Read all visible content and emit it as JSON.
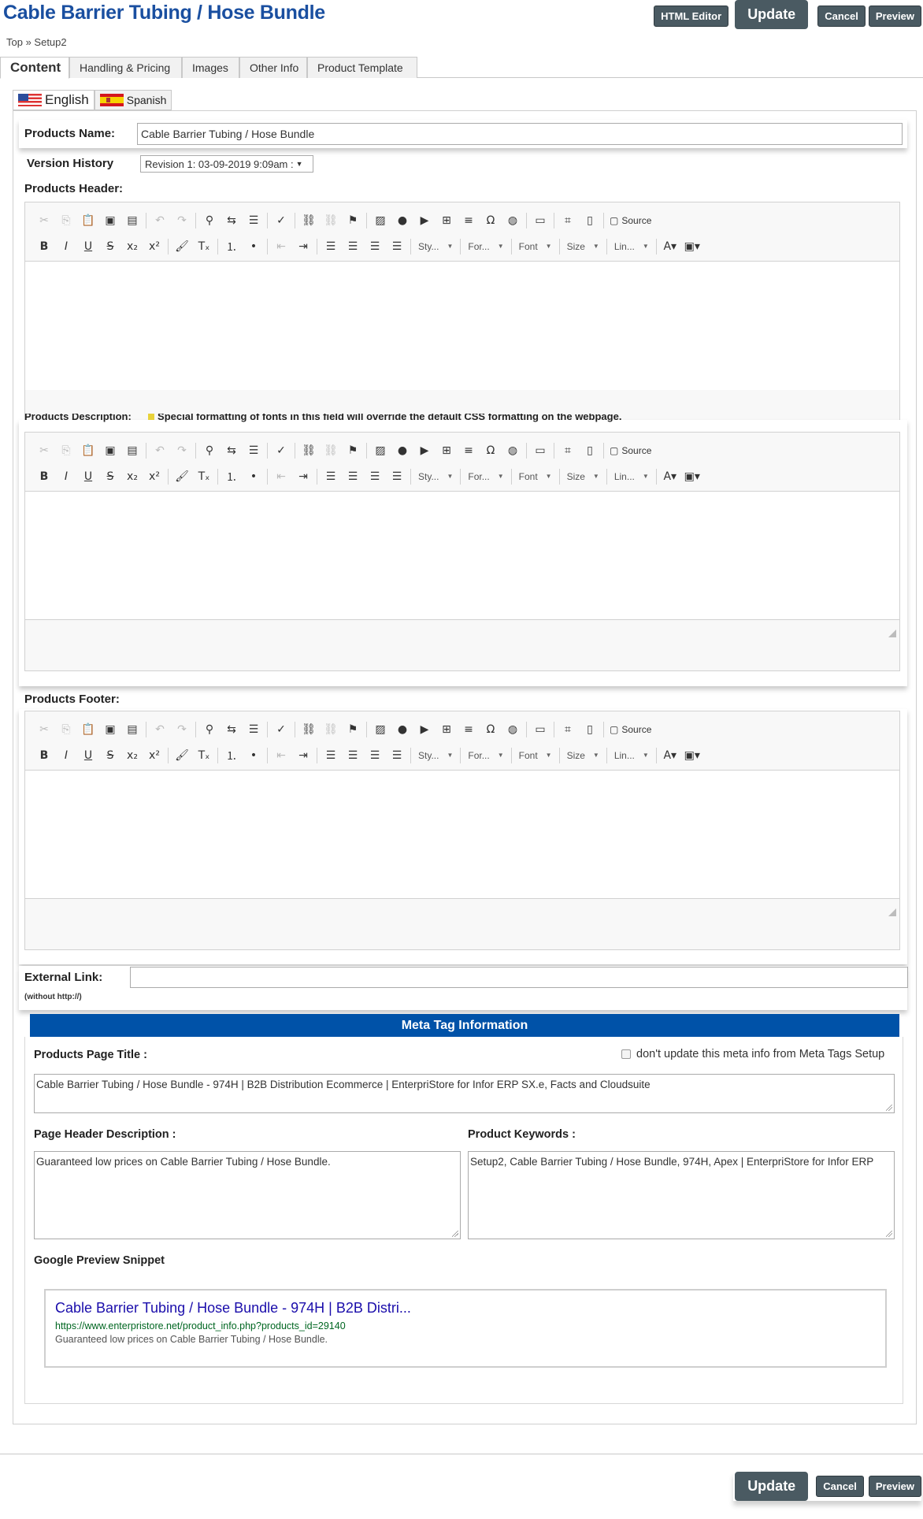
{
  "header": {
    "title": "Cable Barrier Tubing / Hose Bundle",
    "buttons": {
      "html_editor": "HTML Editor",
      "update": "Update",
      "cancel": "Cancel",
      "preview": "Preview"
    },
    "breadcrumb": "Top » Setup2"
  },
  "tabs": [
    "Content",
    "Handling & Pricing",
    "Images",
    "Other Info",
    "Product Template"
  ],
  "languages": [
    "English",
    "Spanish"
  ],
  "form": {
    "products_name_label": "Products Name:",
    "products_name_value": "Cable Barrier Tubing / Hose Bundle",
    "version_history_label": "Version History",
    "version_history_value": "Revision 1: 03-09-2019 9:09am :",
    "products_header_label": "Products Header:",
    "products_description_label": "Products Description:",
    "products_description_note": "Special formatting of fonts in this field will override the default CSS formatting on the webpage.",
    "products_footer_label": "Products Footer:",
    "external_link_label": "External Link:",
    "external_link_hint": "(without http://)",
    "external_link_value": ""
  },
  "editor_toolbar": {
    "source_label": "Source",
    "styles": "Sty...",
    "format": "For...",
    "font": "Font",
    "size": "Size",
    "line_height": "Lin..."
  },
  "meta": {
    "title": "Meta Tag Information",
    "page_title_label": "Products Page Title :",
    "dont_update_label": "don't update this meta info from Meta Tags Setup",
    "dont_update_checked": false,
    "page_title_value": "Cable Barrier Tubing / Hose Bundle - 974H | B2B Distribution Ecommerce | EnterpriStore for Infor ERP SX.e, Facts and Cloudsuite",
    "header_desc_label": "Page Header Description :",
    "header_desc_value": "Guaranteed low prices on Cable Barrier Tubing / Hose Bundle.",
    "keywords_label": "Product Keywords :",
    "keywords_value": "Setup2,  Cable Barrier Tubing / Hose Bundle, 974H, Apex | EnterpriStore for Infor ERP",
    "snippet_label": "Google Preview Snippet",
    "snippet": {
      "title": "Cable Barrier Tubing / Hose Bundle - 974H | B2B Distri...",
      "url": "https://www.enterpristore.net/product_info.php?products_id=29140",
      "description": "Guaranteed low prices on Cable Barrier Tubing / Hose Bundle."
    }
  },
  "colors": {
    "title": "#1a4fa0",
    "button_bg": "#4a5a62",
    "meta_bar": "#0052a8",
    "snippet_title": "#1a0dab",
    "snippet_url": "#006621"
  }
}
